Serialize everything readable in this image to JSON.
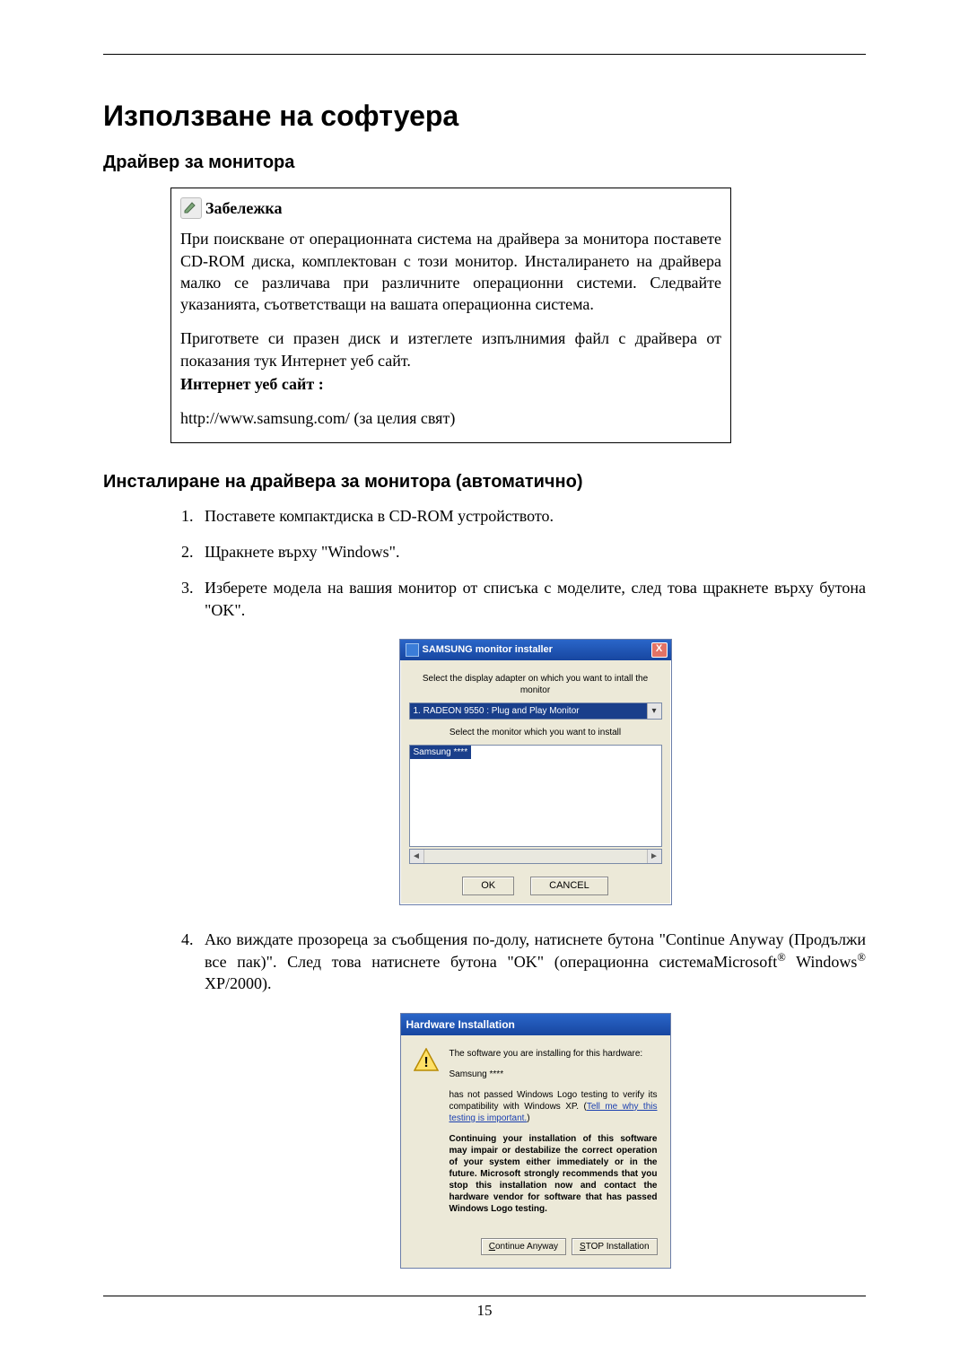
{
  "title": "Използване на софтуера",
  "sub1": "Драйвер за монитора",
  "note": {
    "label": "Забележка",
    "p1": "При поискване от операционната система на драйвера за монитора поставете CD-ROM диска, комплектован с този монитор. Инсталирането на драйвера малко се различава при различните операционни системи. Следвайте указанията, съответстващи на вашата операционна система.",
    "p2": "Пригответе си празен диск и изтеглете изпълнимия файл с драйвера от показания тук Интернет уеб сайт.",
    "p3_bold": "Интернет уеб сайт :",
    "p4": "http://www.samsung.com/ (за целия свят)"
  },
  "sub2": "Инсталиране на драйвера за монитора (автоматично)",
  "steps": {
    "s1": "Поставете компактдиска в CD-ROM устройството.",
    "s2": "Щракнете върху \"Windows\".",
    "s3": "Изберете модела на вашия монитор от списъка с моделите, след това щракнете върху бутона \"OK\".",
    "s4_a": "Ако виждате прозореца за съобщения по-долу, натиснете бутона \"Continue Anyway (Продължи все пак)\". След това натиснете бутона \"OK\" (операционна системаMicrosoft",
    "s4_b": " Windows",
    "s4_c": " XP/2000)."
  },
  "installer": {
    "title": "SAMSUNG monitor installer",
    "close": "X",
    "line1": "Select the display adapter on which you want to intall the monitor",
    "select_value": "1. RADEON 9550 : Plug and Play Monitor",
    "chevron": "▾",
    "line2": "Select the monitor which you want to install",
    "list_item": "Samsung ****",
    "scroll_left": "◄",
    "scroll_right": "►",
    "ok": "OK",
    "cancel": "CANCEL"
  },
  "hardware": {
    "title": "Hardware Installation",
    "warn_char": "!",
    "p1": "The software you are installing for this hardware:",
    "p2": "Samsung ****",
    "p3a": "has not passed Windows Logo testing to verify its compatibility with Windows XP. (",
    "p3_link": "Tell me why this testing is important.",
    "p3b": ")",
    "p4": "Continuing your installation of this software may impair or destabilize the correct operation of your system either immediately or in the future. Microsoft strongly recommends that you stop this installation now and contact the hardware vendor for software that has passed Windows Logo testing.",
    "btn_continue_u": "C",
    "btn_continue_rest": "ontinue Anyway",
    "btn_stop_u": "S",
    "btn_stop_rest": "TOP Installation"
  },
  "page_number": "15"
}
